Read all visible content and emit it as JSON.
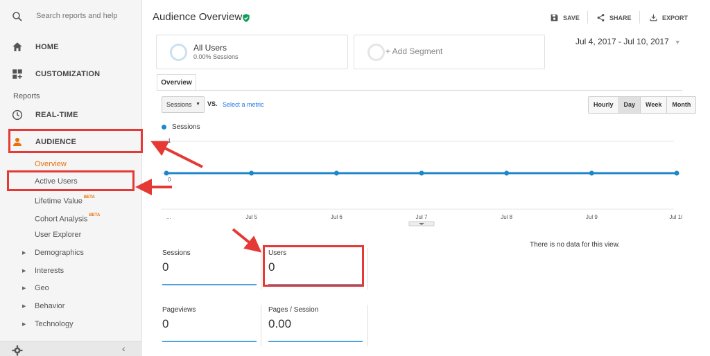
{
  "sidebar": {
    "search_placeholder": "Search reports and help",
    "home": "HOME",
    "customization": "CUSTOMIZATION",
    "reports_section": "Reports",
    "realtime": "REAL-TIME",
    "audience": "AUDIENCE",
    "audience_items": [
      {
        "label": "Overview",
        "badge": ""
      },
      {
        "label": "Active Users",
        "badge": ""
      },
      {
        "label": "Lifetime Value",
        "badge": "BETA"
      },
      {
        "label": "Cohort Analysis",
        "badge": "BETA"
      },
      {
        "label": "User Explorer",
        "badge": ""
      }
    ],
    "audience_groups": [
      "Demographics",
      "Interests",
      "Geo",
      "Behavior",
      "Technology"
    ]
  },
  "header": {
    "title": "Audience Overview",
    "save": "SAVE",
    "share": "SHARE",
    "export": "EXPORT"
  },
  "segments": {
    "active_name": "All Users",
    "active_sub": "0.00% Sessions",
    "add_label": "+ Add Segment"
  },
  "date_range": "Jul 4, 2017 - Jul 10, 2017",
  "tabs": [
    "Overview"
  ],
  "controls": {
    "metric": "Sessions",
    "vs": "VS.",
    "select_metric": "Select a metric",
    "granularity": [
      "Hourly",
      "Day",
      "Week",
      "Month"
    ],
    "granularity_selected": "Day"
  },
  "chart_data": {
    "type": "line",
    "series": [
      {
        "name": "Sessions",
        "values": [
          0,
          0,
          0,
          0,
          0,
          0,
          0
        ]
      }
    ],
    "x": [
      "...",
      "Jul 5",
      "Jul 6",
      "Jul 7",
      "Jul 8",
      "Jul 9",
      "Jul 10"
    ],
    "yticks": [
      "1",
      "0"
    ],
    "ylim": [
      0,
      1
    ],
    "grid": true,
    "color": "#1f87c9"
  },
  "kpis": [
    {
      "label": "Sessions",
      "value": "0"
    },
    {
      "label": "Users",
      "value": "0"
    },
    {
      "label": "Pageviews",
      "value": "0"
    },
    {
      "label": "Pages / Session",
      "value": "0.00"
    }
  ],
  "no_data_text": "There is no data for this view.",
  "colors": {
    "accent_orange": "#e8710a",
    "link_blue": "#1a73e8",
    "annotation_red": "#e53935",
    "series_blue": "#1f87c9"
  }
}
